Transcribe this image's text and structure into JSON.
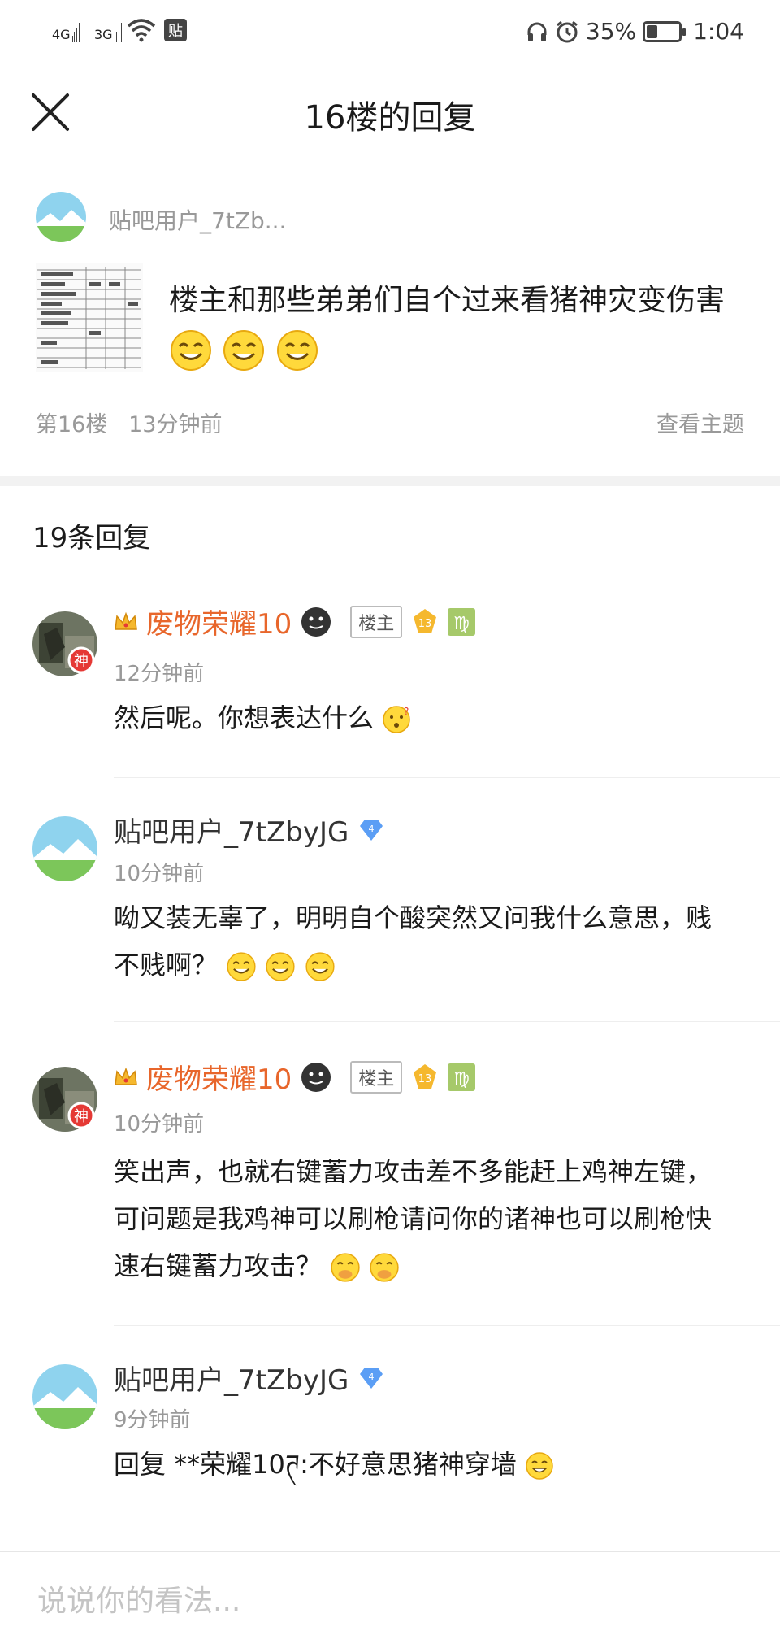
{
  "status_bar": {
    "net1": "4G",
    "net2": "3G",
    "tie_label": "贴",
    "battery": "35%",
    "battery_level": 0.35,
    "time": "1:04"
  },
  "header": {
    "title": "16楼的回复"
  },
  "main_post": {
    "username": "贴吧用户_7tZb...",
    "content": "楼主和那些弟弟们自个过来看猪神灾变伤害",
    "floor": "第16楼",
    "time": "13分钟前",
    "view_topic": "查看主题"
  },
  "reply_count": "19条回复",
  "replies": [
    {
      "username": "废物荣耀10",
      "is_owner": true,
      "owner_badge": "楼主",
      "level": "13",
      "avatar_badge": "神",
      "time": "12分钟前",
      "content": "然后呢。你想表达什么"
    },
    {
      "username": "贴吧用户_7tZbyJG",
      "is_owner": false,
      "level": "4",
      "time": "10分钟前",
      "content": "呦又装无辜了，明明自个酸突然又问我什么意思，贱不贱啊？"
    },
    {
      "username": "废物荣耀10",
      "is_owner": true,
      "owner_badge": "楼主",
      "level": "13",
      "avatar_badge": "神",
      "time": "10分钟前",
      "content": "笑出声，也就右键蓄力攻击差不多能赶上鸡神左键，可问题是我鸡神可以刷枪请问你的诸神也可以刷枪快速右键蓄力攻击？"
    },
    {
      "username": "贴吧用户_7tZbyJG",
      "is_owner": false,
      "level": "4",
      "time": "9分钟前",
      "content": "回复 **荣耀10ཊ:不好意思猪神穿墙"
    }
  ],
  "input": {
    "placeholder": "说说你的看法..."
  },
  "colors": {
    "owner_name": "#e8662b",
    "meta_gray": "#999999",
    "level_gold": "#f5b82e",
    "diamond_blue": "#5b9ef5",
    "god_badge_red": "#e53935"
  }
}
